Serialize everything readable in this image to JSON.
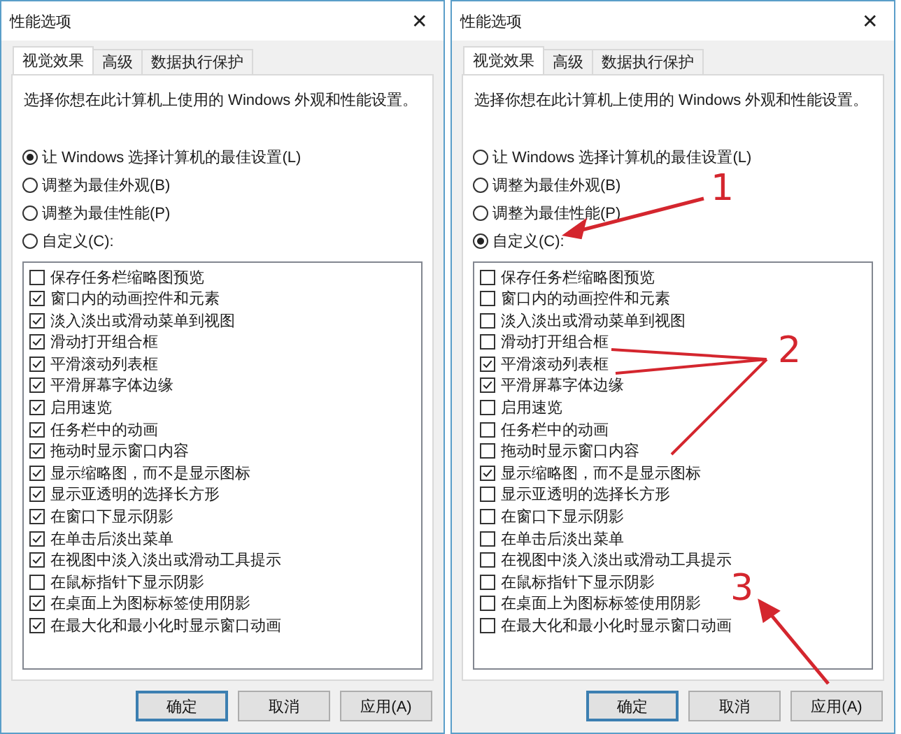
{
  "dialogs": [
    {
      "title": "性能选项",
      "close": "✕",
      "tabs": [
        {
          "label": "视觉效果",
          "selected": true
        },
        {
          "label": "高级",
          "selected": false
        },
        {
          "label": "数据执行保护",
          "selected": false
        }
      ],
      "description": "选择你想在此计算机上使用的 Windows 外观和性能设置。",
      "options": [
        {
          "label": "让 Windows 选择计算机的最佳设置(L)",
          "selected": true
        },
        {
          "label": "调整为最佳外观(B)",
          "selected": false
        },
        {
          "label": "调整为最佳性能(P)",
          "selected": false
        },
        {
          "label": "自定义(C):",
          "selected": false
        }
      ],
      "effects": [
        {
          "label": "保存任务栏缩略图预览",
          "checked": false
        },
        {
          "label": "窗口内的动画控件和元素",
          "checked": true
        },
        {
          "label": "淡入淡出或滑动菜单到视图",
          "checked": true
        },
        {
          "label": "滑动打开组合框",
          "checked": true
        },
        {
          "label": "平滑滚动列表框",
          "checked": true
        },
        {
          "label": "平滑屏幕字体边缘",
          "checked": true
        },
        {
          "label": "启用速览",
          "checked": true
        },
        {
          "label": "任务栏中的动画",
          "checked": true
        },
        {
          "label": "拖动时显示窗口内容",
          "checked": true
        },
        {
          "label": "显示缩略图，而不是显示图标",
          "checked": true
        },
        {
          "label": "显示亚透明的选择长方形",
          "checked": true
        },
        {
          "label": "在窗口下显示阴影",
          "checked": true
        },
        {
          "label": "在单击后淡出菜单",
          "checked": true
        },
        {
          "label": "在视图中淡入淡出或滑动工具提示",
          "checked": true
        },
        {
          "label": "在鼠标指针下显示阴影",
          "checked": false
        },
        {
          "label": "在桌面上为图标标签使用阴影",
          "checked": true
        },
        {
          "label": "在最大化和最小化时显示窗口动画",
          "checked": true
        }
      ],
      "buttons": [
        {
          "label": "确定",
          "default": true
        },
        {
          "label": "取消",
          "default": false
        },
        {
          "label": "应用(A)",
          "default": false
        }
      ]
    },
    {
      "title": "性能选项",
      "close": "✕",
      "tabs": [
        {
          "label": "视觉效果",
          "selected": true
        },
        {
          "label": "高级",
          "selected": false
        },
        {
          "label": "数据执行保护",
          "selected": false
        }
      ],
      "description": "选择你想在此计算机上使用的 Windows 外观和性能设置。",
      "options": [
        {
          "label": "让 Windows 选择计算机的最佳设置(L)",
          "selected": false
        },
        {
          "label": "调整为最佳外观(B)",
          "selected": false
        },
        {
          "label": "调整为最佳性能(P)",
          "selected": false
        },
        {
          "label": "自定义(C):",
          "selected": true
        }
      ],
      "effects": [
        {
          "label": "保存任务栏缩略图预览",
          "checked": false
        },
        {
          "label": "窗口内的动画控件和元素",
          "checked": false
        },
        {
          "label": "淡入淡出或滑动菜单到视图",
          "checked": false
        },
        {
          "label": "滑动打开组合框",
          "checked": false
        },
        {
          "label": "平滑滚动列表框",
          "checked": true
        },
        {
          "label": "平滑屏幕字体边缘",
          "checked": true
        },
        {
          "label": "启用速览",
          "checked": false
        },
        {
          "label": "任务栏中的动画",
          "checked": false
        },
        {
          "label": "拖动时显示窗口内容",
          "checked": false
        },
        {
          "label": "显示缩略图，而不是显示图标",
          "checked": true
        },
        {
          "label": "显示亚透明的选择长方形",
          "checked": false
        },
        {
          "label": "在窗口下显示阴影",
          "checked": false
        },
        {
          "label": "在单击后淡出菜单",
          "checked": false
        },
        {
          "label": "在视图中淡入淡出或滑动工具提示",
          "checked": false
        },
        {
          "label": "在鼠标指针下显示阴影",
          "checked": false
        },
        {
          "label": "在桌面上为图标标签使用阴影",
          "checked": false
        },
        {
          "label": "在最大化和最小化时显示窗口动画",
          "checked": false
        }
      ],
      "buttons": [
        {
          "label": "确定",
          "default": true
        },
        {
          "label": "取消",
          "default": false
        },
        {
          "label": "应用(A)",
          "default": false
        }
      ]
    }
  ],
  "annotations": [
    {
      "label": "1"
    },
    {
      "label": "2"
    },
    {
      "label": "3"
    }
  ]
}
